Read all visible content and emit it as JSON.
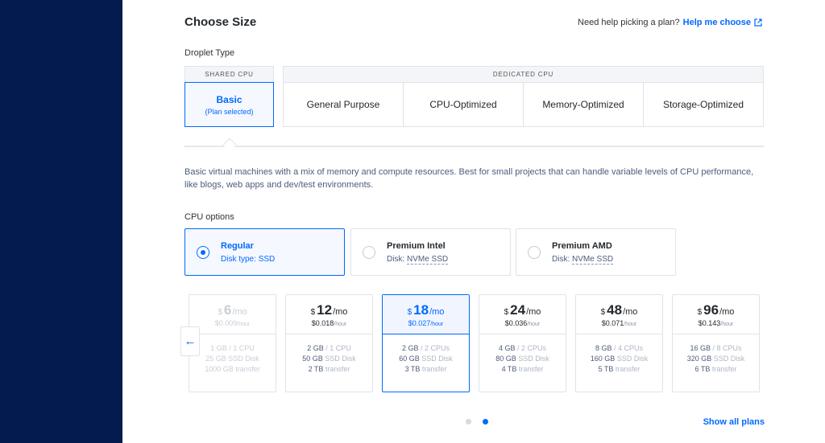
{
  "header": {
    "title": "Choose Size",
    "help_text": "Need help picking a plan?",
    "help_link": "Help me choose"
  },
  "droplet_type": {
    "label": "Droplet Type",
    "shared_header": "SHARED CPU",
    "basic_name": "Basic",
    "basic_sub": "(Plan selected)",
    "dedicated_header": "DEDICATED CPU",
    "dedicated_options": [
      "General Purpose",
      "CPU-Optimized",
      "Memory-Optimized",
      "Storage-Optimized"
    ]
  },
  "description": "Basic virtual machines with a mix of memory and compute resources. Best for small projects that can handle variable levels of CPU performance, like blogs, web apps and dev/test environments.",
  "cpu_options": {
    "label": "CPU options",
    "items": [
      {
        "name": "Regular",
        "prefix": "Disk type: ",
        "disk": "SSD",
        "selected": true
      },
      {
        "name": "Premium Intel",
        "prefix": "Disk: ",
        "disk": "NVMe SSD",
        "selected": false
      },
      {
        "name": "Premium AMD",
        "prefix": "Disk: ",
        "disk": "NVMe SSD",
        "selected": false
      }
    ]
  },
  "plans": [
    {
      "currency": "$",
      "price": "6",
      "per": "/mo",
      "hourly": "$0.009",
      "hourly_unit": "/hour",
      "mem": "1 GB",
      "cpu": "/ 1 CPU",
      "disk": "25 GB",
      "disk_unit": "SSD Disk",
      "transfer": "1000 GB",
      "transfer_unit": "transfer"
    },
    {
      "currency": "$",
      "price": "12",
      "per": "/mo",
      "hourly": "$0.018",
      "hourly_unit": "/hour",
      "mem": "2 GB",
      "cpu": "/ 1 CPU",
      "disk": "50 GB",
      "disk_unit": "SSD Disk",
      "transfer": "2 TB",
      "transfer_unit": "transfer"
    },
    {
      "currency": "$",
      "price": "18",
      "per": "/mo",
      "hourly": "$0.027",
      "hourly_unit": "/hour",
      "mem": "2 GB",
      "cpu": "/ 2 CPUs",
      "disk": "60 GB",
      "disk_unit": "SSD Disk",
      "transfer": "3 TB",
      "transfer_unit": "transfer"
    },
    {
      "currency": "$",
      "price": "24",
      "per": "/mo",
      "hourly": "$0.036",
      "hourly_unit": "/hour",
      "mem": "4 GB",
      "cpu": "/ 2 CPUs",
      "disk": "80 GB",
      "disk_unit": "SSD Disk",
      "transfer": "4 TB",
      "transfer_unit": "transfer"
    },
    {
      "currency": "$",
      "price": "48",
      "per": "/mo",
      "hourly": "$0.071",
      "hourly_unit": "/hour",
      "mem": "8 GB",
      "cpu": "/ 4 CPUs",
      "disk": "160 GB",
      "disk_unit": "SSD Disk",
      "transfer": "5 TB",
      "transfer_unit": "transfer"
    },
    {
      "currency": "$",
      "price": "96",
      "per": "/mo",
      "hourly": "$0.143",
      "hourly_unit": "/hour",
      "mem": "16 GB",
      "cpu": "/ 8 CPUs",
      "disk": "320 GB",
      "disk_unit": "SSD Disk",
      "transfer": "6 TB",
      "transfer_unit": "transfer"
    }
  ],
  "carousel": {
    "left_arrow": "←",
    "page_count": 2,
    "active_page": 2
  },
  "footer": {
    "show_all": "Show all plans"
  },
  "colors": {
    "sidebar": "#031b4e",
    "accent": "#0069ff",
    "border": "#dfe3e8"
  }
}
